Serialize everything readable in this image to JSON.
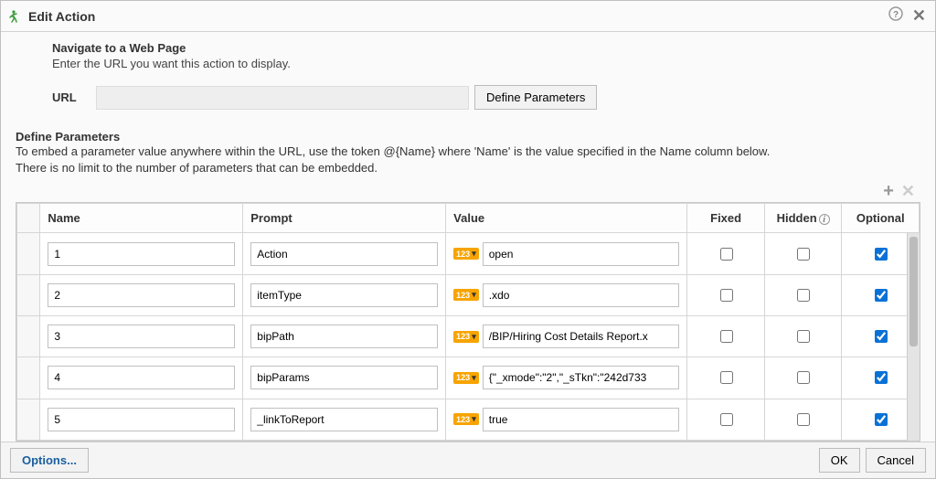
{
  "dialog": {
    "title": "Edit Action"
  },
  "nav": {
    "heading": "Navigate to a Web Page",
    "subtext": "Enter the URL you want this action to display."
  },
  "url": {
    "label": "URL",
    "value": "",
    "define_btn": "Define Parameters"
  },
  "define_params": {
    "heading": "Define Parameters",
    "desc_line1": "To embed a parameter value anywhere within the URL, use the token @{Name} where 'Name' is the value specified in the Name column below.",
    "desc_line2": "There is no limit to the number of parameters that can be embedded."
  },
  "table": {
    "headers": {
      "name": "Name",
      "prompt": "Prompt",
      "value": "Value",
      "fixed": "Fixed",
      "hidden": "Hidden",
      "optional": "Optional"
    },
    "type_badge": "123",
    "rows": [
      {
        "name": "1",
        "prompt": "Action",
        "value": "open",
        "fixed": false,
        "hidden": false,
        "optional": true
      },
      {
        "name": "2",
        "prompt": "itemType",
        "value": ".xdo",
        "fixed": false,
        "hidden": false,
        "optional": true
      },
      {
        "name": "3",
        "prompt": "bipPath",
        "value": "/BIP/Hiring Cost Details Report.x",
        "fixed": false,
        "hidden": false,
        "optional": true
      },
      {
        "name": "4",
        "prompt": "bipParams",
        "value": "{\"_xmode\":\"2\",\"_sTkn\":\"242d733",
        "fixed": false,
        "hidden": false,
        "optional": true
      },
      {
        "name": "5",
        "prompt": "_linkToReport",
        "value": "true",
        "fixed": false,
        "hidden": false,
        "optional": true
      }
    ]
  },
  "footer": {
    "options": "Options...",
    "ok": "OK",
    "cancel": "Cancel"
  }
}
